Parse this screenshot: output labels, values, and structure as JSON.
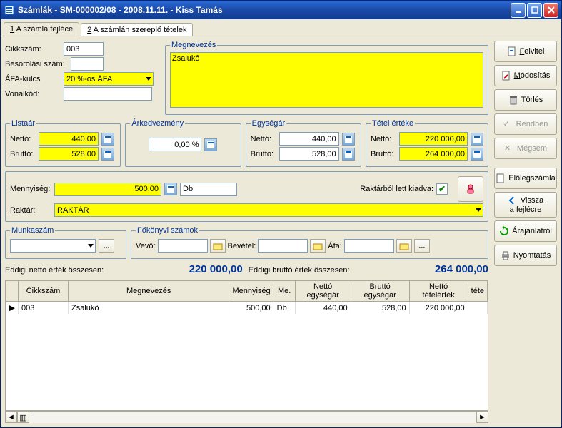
{
  "title": "Számlák  -  SM-000002/08  -  2008.11.11.  -  Kiss Tamás",
  "tabs": {
    "t1_prefix": "1",
    "t1_label": " A számla fejléce",
    "t2_prefix": "2",
    "t2_label": " A számlán szereplő tételek"
  },
  "sidebar": {
    "felvitel": "Felvitel",
    "modositas": "Módosítás",
    "torles": "Törlés",
    "rendben": "Rendben",
    "megsem": "Mégsem",
    "elolegszamla": "Előlegszámla",
    "vissza1": "Vissza",
    "vissza2": "a fejlécre",
    "arajanlat": "Árajánlatról",
    "nyomtatas": "Nyomtatás"
  },
  "fields": {
    "cikkszam_lbl": "Cikkszám:",
    "cikkszam_val": "003",
    "besorolasi_lbl": "Besorolási szám:",
    "besorolasi_val": "",
    "afa_lbl": "ÁFA-kulcs",
    "afa_val": "20 %-os ÁFA",
    "vonalkod_lbl": "Vonalkód:",
    "vonalkod_val": "",
    "megnevezes_legend": "Megnevezés",
    "megnevezes_val": "Zsalukő"
  },
  "listaar": {
    "legend": "Listaár",
    "netto_lbl": "Nettó:",
    "netto_val": "440,00",
    "brutto_lbl": "Bruttó:",
    "brutto_val": "528,00"
  },
  "arkedv": {
    "legend": "Árkedvezmény",
    "val": "0,00 %"
  },
  "egysegar": {
    "legend": "Egységár",
    "netto_lbl": "Nettó:",
    "netto_val": "440,00",
    "brutto_lbl": "Bruttó:",
    "brutto_val": "528,00"
  },
  "tetelertek": {
    "legend": "Tétel értéke",
    "netto_lbl": "Nettó:",
    "netto_val": "220 000,00",
    "brutto_lbl": "Bruttó:",
    "brutto_val": "264 000,00"
  },
  "qty": {
    "mennyiseg_lbl": "Mennyiség:",
    "mennyiseg_val": "500,00",
    "db_val": "Db",
    "raktarbolkiadva_lbl": "Raktárból lett kiadva:",
    "raktar_lbl": "Raktár:",
    "raktar_val": "RAKTÁR"
  },
  "munka": {
    "munkaszam_legend": "Munkaszám",
    "fokonyvi_legend": "Főkönyvi számok",
    "vevo_lbl": "Vevő:",
    "bevetel_lbl": "Bevétel:",
    "afa_lbl": "Áfa:"
  },
  "totals": {
    "netto_lbl": "Eddigi nettó érték összesen:",
    "netto_val": "220 000,00",
    "brutto_lbl": "Eddigi bruttó érték összesen:",
    "brutto_val": "264 000,00"
  },
  "grid": {
    "headers": {
      "cikkszam": "Cikkszám",
      "megnevezes": "Megnevezés",
      "mennyiseg": "Mennyiség",
      "me": "Me.",
      "netto_e": "Nettó egységár",
      "brutto_e": "Bruttó egységár",
      "netto_t": "Nettó tételérték",
      "tete": "téte"
    },
    "rows": [
      {
        "cikkszam": "003",
        "megnevezes": "Zsalukő",
        "mennyiseg": "500,00",
        "me": "Db",
        "netto_e": "440,00",
        "brutto_e": "528,00",
        "netto_t": "220 000,00"
      }
    ]
  }
}
